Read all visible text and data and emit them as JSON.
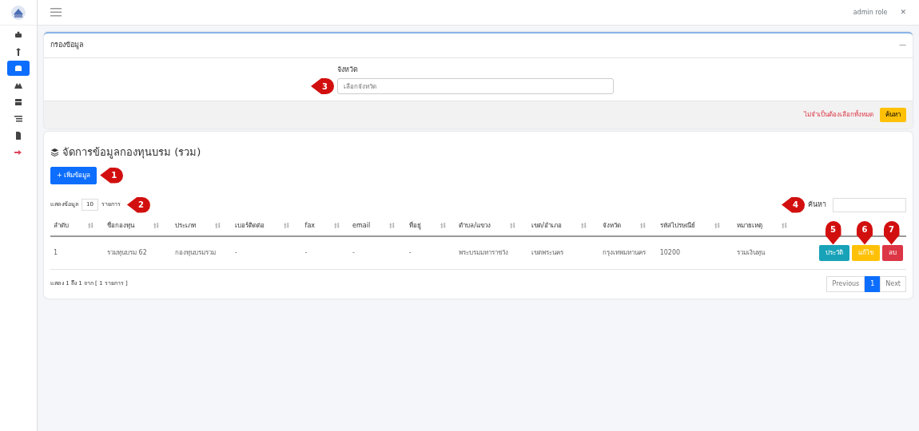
{
  "sidebar": {
    "items": [
      {
        "kind": "nav",
        "selected": false
      },
      {
        "kind": "nav",
        "selected": false
      },
      {
        "kind": "nav",
        "selected": true
      },
      {
        "kind": "nav",
        "selected": false
      },
      {
        "kind": "nav",
        "selected": false
      },
      {
        "kind": "nav",
        "selected": false
      },
      {
        "kind": "nav",
        "selected": false
      },
      {
        "kind": "logout",
        "selected": false
      }
    ]
  },
  "topbar": {
    "user": "admin role",
    "close": "✕"
  },
  "filter": {
    "title": "กรองข้อมูล",
    "collapse": "—",
    "field_label": "จังหวัด",
    "placeholder": "เลือกจังหวัด",
    "note": "ไม่จำเป็นต้องเลือกทั้งหมด",
    "search_button": "ค้นหา",
    "marker": "3"
  },
  "manage": {
    "title": "จัดการข้อมูลกองทุนบรม (รวม)",
    "add_button": "+ เพิ่มข้อมูล",
    "add_marker": "1",
    "length_prefix": "แสดงข้อมูล",
    "length_value": "10",
    "length_suffix": "รายการ",
    "length_marker": "2",
    "search_label": "ค้นหา",
    "search_marker": "4",
    "columns": [
      "ลำดับ",
      "ชื่อกองทุน",
      "ประเภท",
      "เบอร์ติดต่อ",
      "fax",
      "email",
      "ที่อยู่",
      "ตำบล/แขวง",
      "เขต/อำเภอ",
      "จังหวัด",
      "รหัสไปรษณีย์",
      "หมายเหตุ"
    ],
    "rows": [
      {
        "cells": [
          "1",
          "รวมทุนบรม 62",
          "กองทุนบรมรวม",
          "-",
          "-",
          "-",
          "-",
          "พระบรมมหาราชวัง",
          "เขตพระนคร",
          "กรุงเทพมหานคร",
          "10200",
          "รวมเงินทุน"
        ],
        "actions": [
          {
            "kind": "info",
            "label": "ประวัติ",
            "marker": "5"
          },
          {
            "kind": "warning",
            "label": "แก้ไข",
            "marker": "6"
          },
          {
            "kind": "danger",
            "label": "ลบ",
            "marker": "7"
          }
        ]
      }
    ],
    "info": "แสดง 1 ถึง 1 จาก [ 1 รายการ ]",
    "pages": [
      {
        "label": "Previous",
        "selected": false
      },
      {
        "label": "1",
        "selected": true
      },
      {
        "label": "Next",
        "selected": false
      }
    ]
  }
}
